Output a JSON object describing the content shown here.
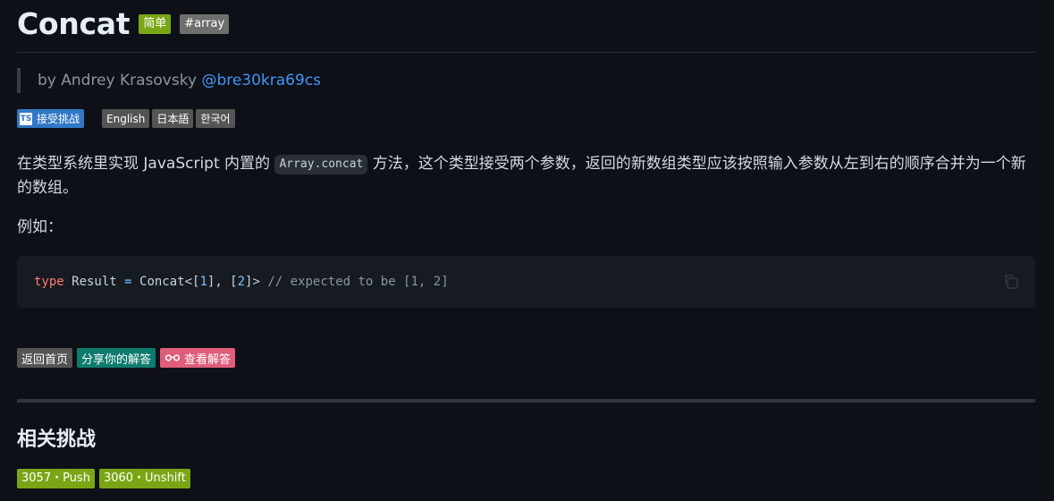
{
  "title": "Concat",
  "difficulty_badge": "简单",
  "tag_badge": "#array",
  "author": {
    "prefix": "by Andrey Krasovsky",
    "handle": "@bre30kra69cs"
  },
  "chips": {
    "accept": "接受挑战",
    "ts_icon_text": "TS",
    "languages": [
      "English",
      "日本語",
      "한국어"
    ]
  },
  "description": {
    "before": "在类型系统里实现 JavaScript 内置的 ",
    "code": "Array.concat",
    "after": " 方法，这个类型接受两个参数，返回的新数组类型应该按照输入参数从左到右的顺序合并为一个新的数组。"
  },
  "example_label": "例如：",
  "code_example": {
    "keyword": "type",
    "name": " Result ",
    "eq": "=",
    "call_start": " Concat<[",
    "arg1": "1",
    "mid": "], [",
    "arg2": "2",
    "call_end": "]>",
    "comment": " // expected to be [1, 2]"
  },
  "actions": {
    "home": "返回首页",
    "share": "分享你的解答",
    "view": "查看解答"
  },
  "related": {
    "title": "相关挑战",
    "items": [
      "3057・Push",
      "3060・Unshift"
    ]
  },
  "colors": {
    "background": "#0d1117",
    "easy_badge": "#7aa615",
    "link": "#4493f8",
    "ts_blue": "#3178c6",
    "share_teal": "#0f7b6f",
    "view_pink": "#e05d7a"
  }
}
